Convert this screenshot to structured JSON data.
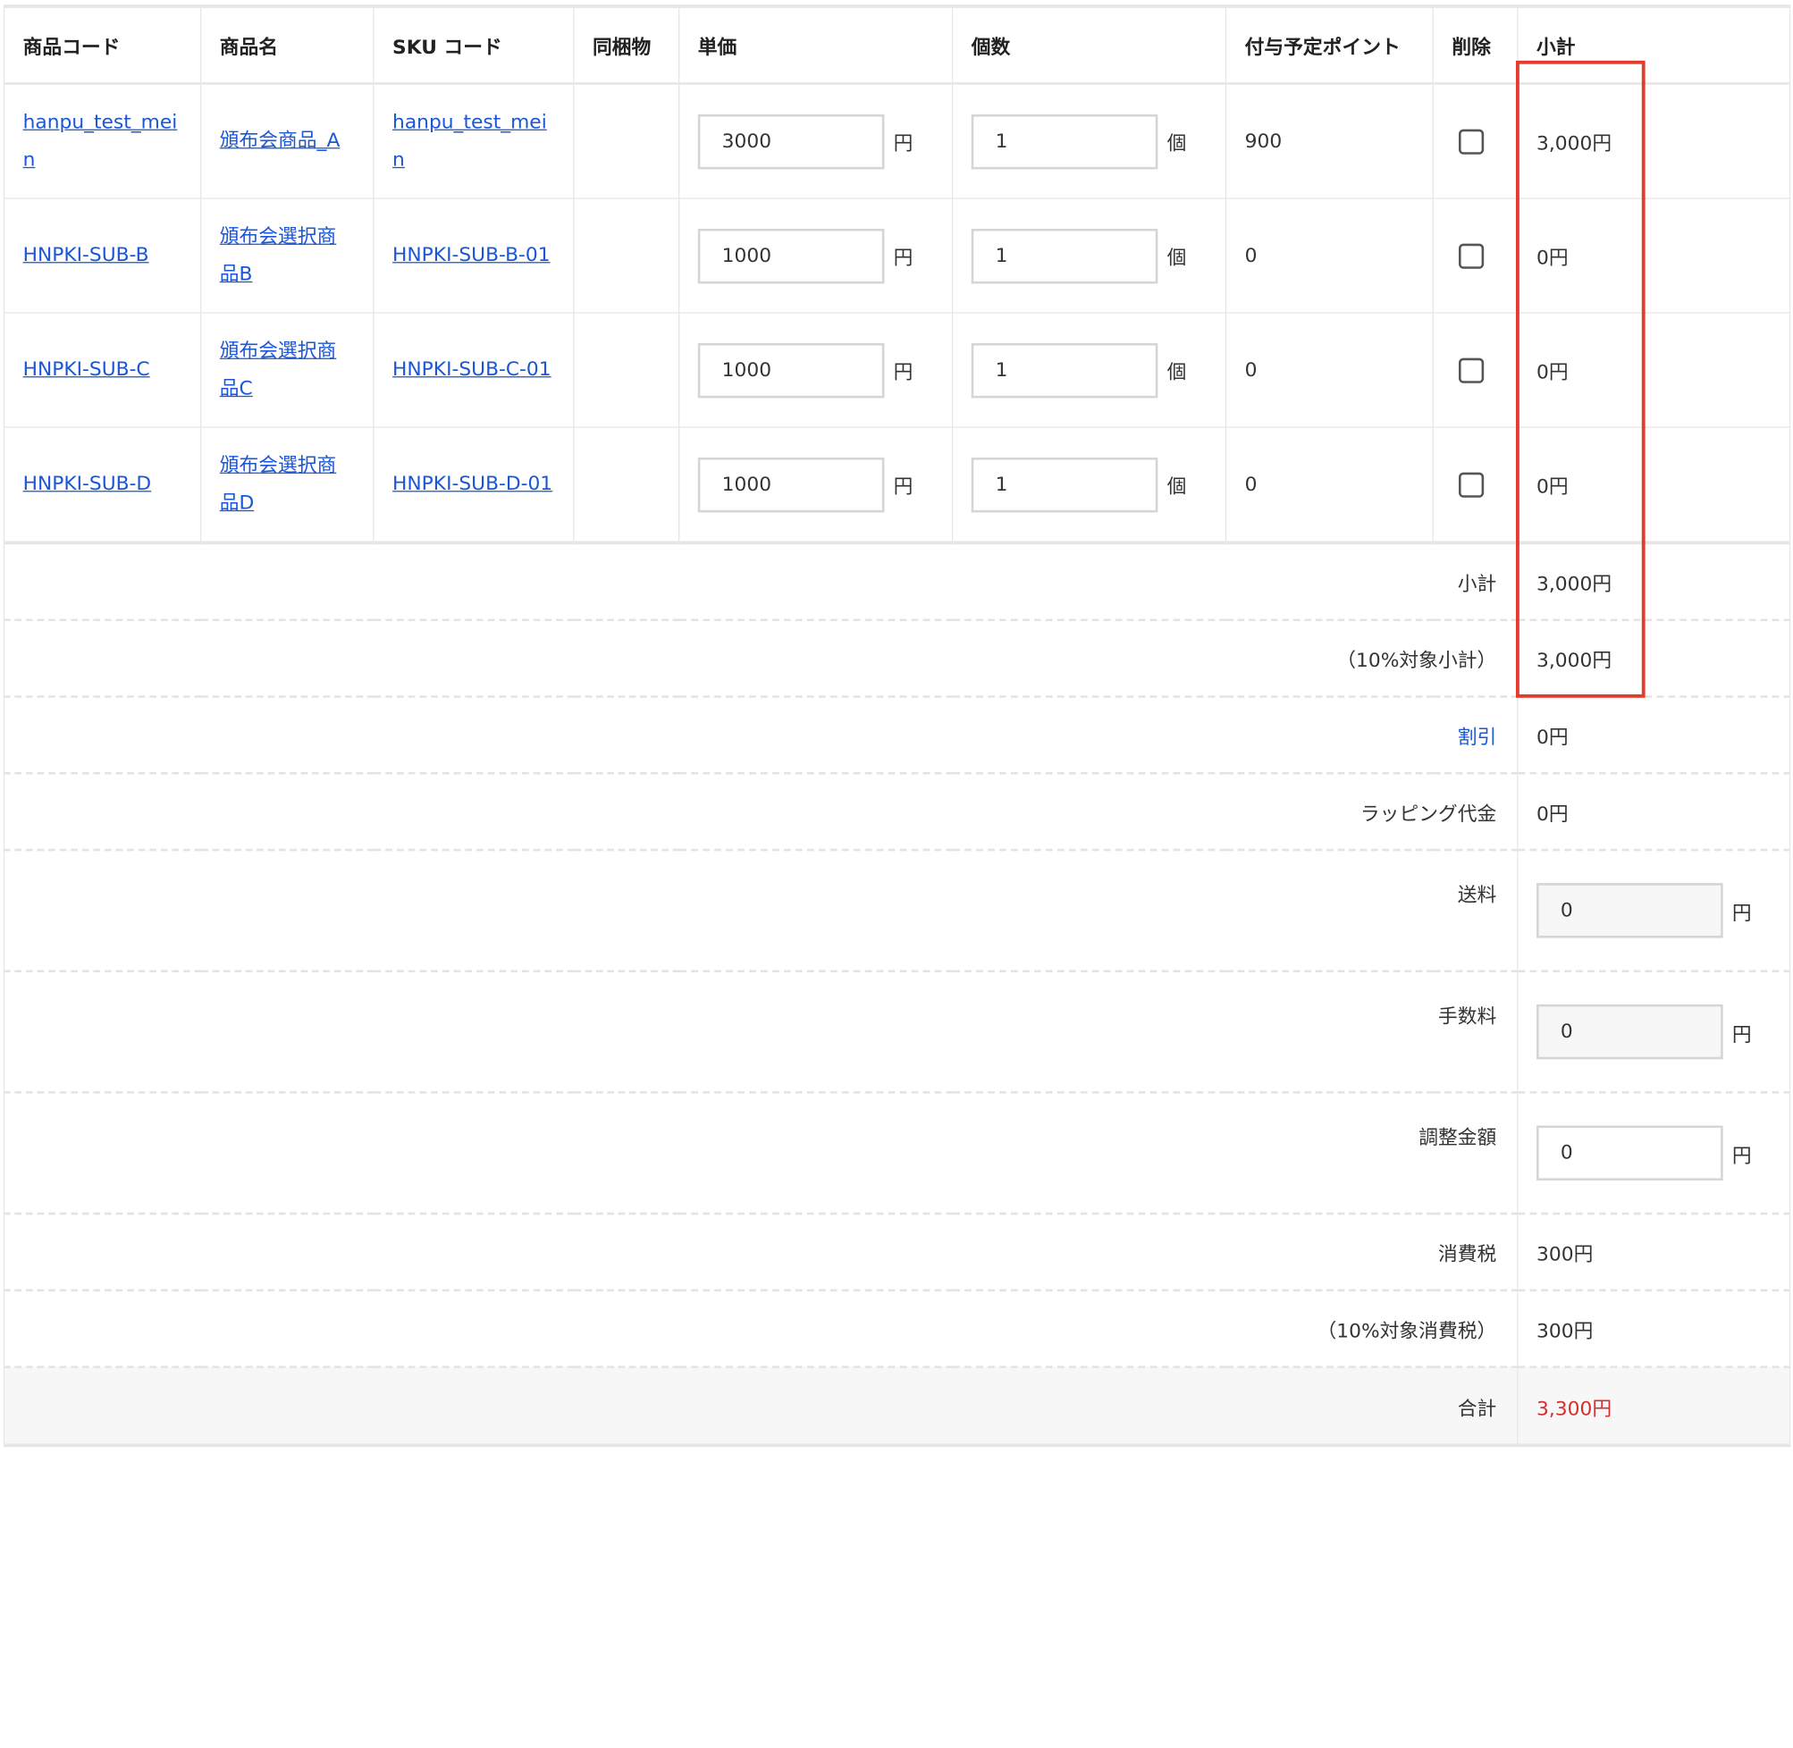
{
  "headers": {
    "product_code": "商品コード",
    "product_name": "商品名",
    "sku_code": "SKU コード",
    "bundle": "同梱物",
    "unit_price": "単価",
    "quantity": "個数",
    "points": "付与予定ポイント",
    "delete": "削除",
    "subtotal": "小計"
  },
  "items": [
    {
      "code": "hanpu_test_mein",
      "name": "頒布会商品_A",
      "sku": "hanpu_test_mein",
      "bundle": "",
      "price": "3000",
      "price_unit": "円",
      "qty": "1",
      "qty_unit": "個",
      "points": "900",
      "delete_checked": false,
      "subtotal": "3,000円"
    },
    {
      "code": "HNPKI-SUB-B",
      "name": "頒布会選択商品B",
      "sku": "HNPKI-SUB-B-01",
      "bundle": "",
      "price": "1000",
      "price_unit": "円",
      "qty": "1",
      "qty_unit": "個",
      "points": "0",
      "delete_checked": false,
      "subtotal": "0円"
    },
    {
      "code": "HNPKI-SUB-C",
      "name": "頒布会選択商品C",
      "sku": "HNPKI-SUB-C-01",
      "bundle": "",
      "price": "1000",
      "price_unit": "円",
      "qty": "1",
      "qty_unit": "個",
      "points": "0",
      "delete_checked": false,
      "subtotal": "0円"
    },
    {
      "code": "HNPKI-SUB-D",
      "name": "頒布会選択商品D",
      "sku": "HNPKI-SUB-D-01",
      "bundle": "",
      "price": "1000",
      "price_unit": "円",
      "qty": "1",
      "qty_unit": "個",
      "points": "0",
      "delete_checked": false,
      "subtotal": "0円"
    }
  ],
  "summary": {
    "subtotal_label": "小計",
    "subtotal_value": "3,000円",
    "subtotal10_label": "（10%対象小計）",
    "subtotal10_value": "3,000円",
    "discount_label": "割引",
    "discount_value": "0円",
    "wrapping_label": "ラッピング代金",
    "wrapping_value": "0円",
    "shipping_label": "送料",
    "shipping_value": "0",
    "fee_label": "手数料",
    "fee_value": "0",
    "adjust_label": "調整金額",
    "adjust_value": "0",
    "yen_unit": "円",
    "tax_label": "消費税",
    "tax_value": "300円",
    "tax10_label": "（10%対象消費税）",
    "tax10_value": "300円",
    "total_label": "合計",
    "total_value": "3,300円"
  },
  "colors": {
    "link": "#1a56d6",
    "total": "#d32f2f",
    "highlight_box": "#e33b2e"
  }
}
